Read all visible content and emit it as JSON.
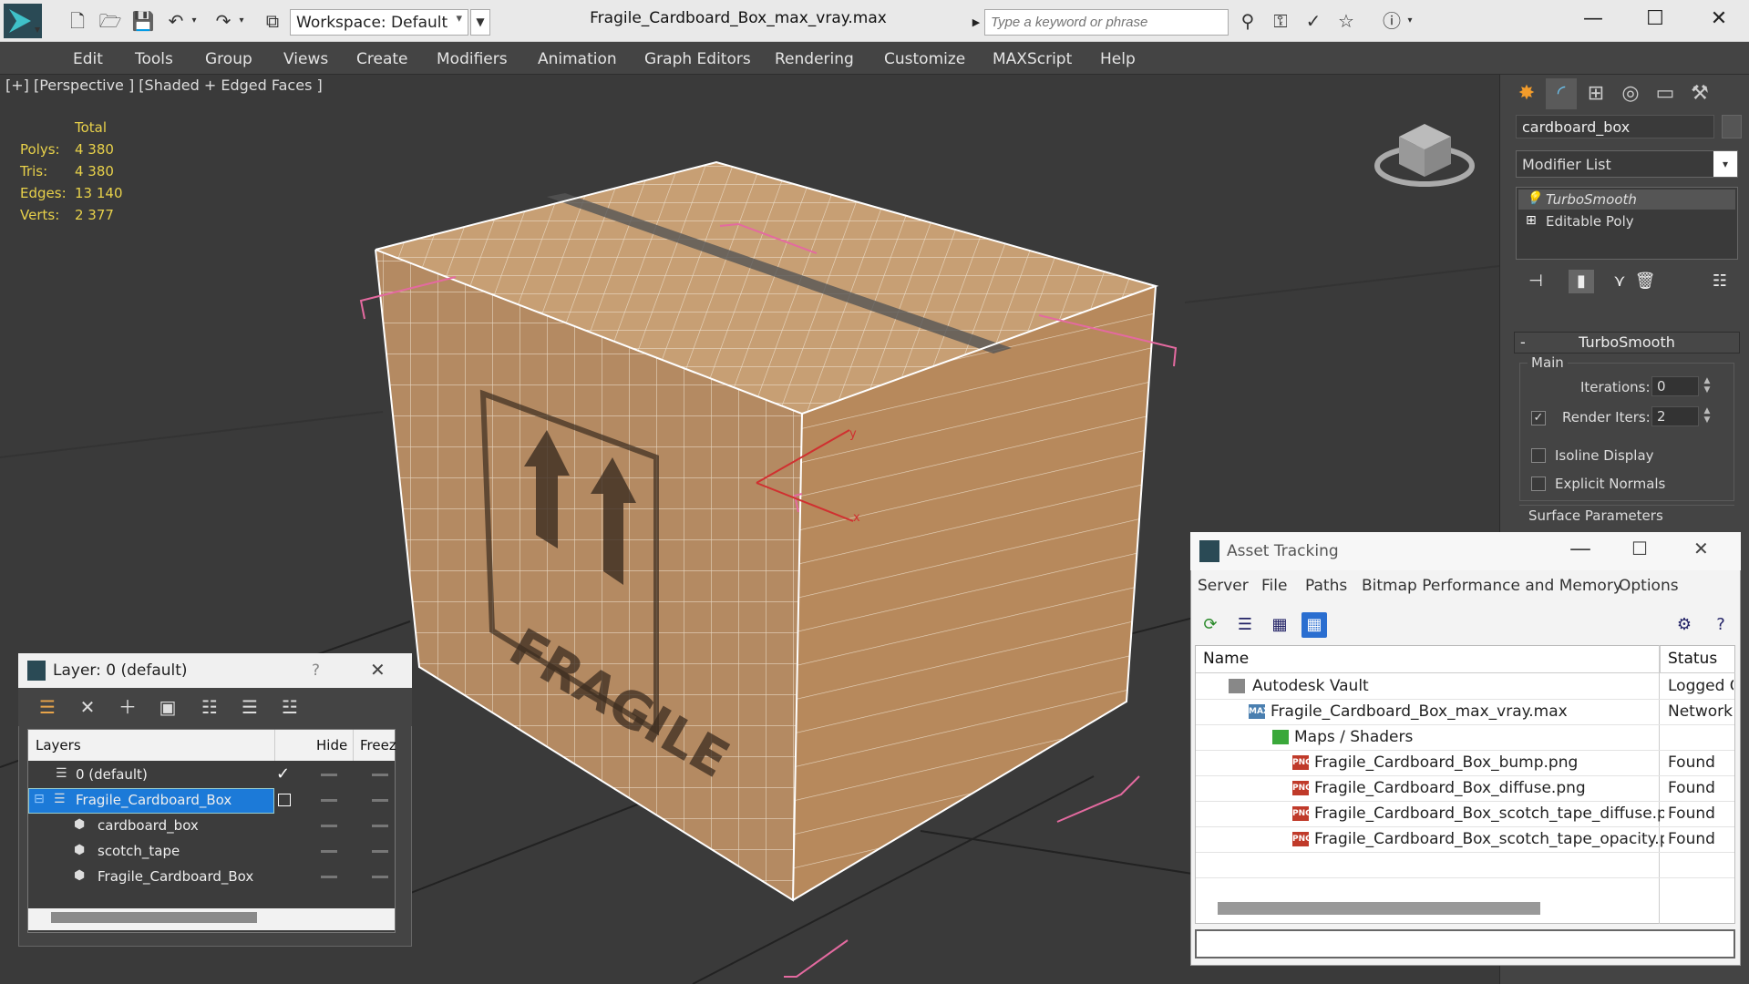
{
  "window": {
    "title": "Fragile_Cardboard_Box_max_vray.max",
    "workspace": "Workspace: Default",
    "search_placeholder": "Type a keyword or phrase",
    "minimize": "—",
    "maximize": "☐",
    "close": "✕"
  },
  "menu": [
    "Edit",
    "Tools",
    "Group",
    "Views",
    "Create",
    "Modifiers",
    "Animation",
    "Graph Editors",
    "Rendering",
    "Customize",
    "MAXScript",
    "Help"
  ],
  "viewport": {
    "label": "[+] [Perspective ] [Shaded + Edged Faces ]",
    "stats_header": "Total",
    "stats": [
      {
        "label": "Polys:",
        "value": "4 380"
      },
      {
        "label": "Tris:",
        "value": "4 380"
      },
      {
        "label": "Edges:",
        "value": "13 140"
      },
      {
        "label": "Verts:",
        "value": "2 377"
      }
    ],
    "box_text": "FRAGILE",
    "gizmo_x": "x",
    "gizmo_y": "y"
  },
  "command_panel": {
    "object_name": "cardboard_box",
    "modifier_list": "Modifier List",
    "stack": [
      "TurboSmooth",
      "Editable Poly"
    ],
    "rollout_title": "TurboSmooth",
    "group_main": "Main",
    "iterations_label": "Iterations:",
    "iterations_value": "0",
    "render_iters_label": "Render Iters:",
    "render_iters_value": "2",
    "isoline_label": "Isoline Display",
    "explicit_normals_label": "Explicit Normals",
    "surface_params": "Surface Parameters"
  },
  "layer_window": {
    "title": "Layer: 0 (default)",
    "help": "?",
    "close": "✕",
    "col_layers": "Layers",
    "col_hide": "Hide",
    "col_freeze": "Freez",
    "rows": [
      {
        "name": "0 (default)",
        "indent": 0,
        "check": "✓"
      },
      {
        "name": "Fragile_Cardboard_Box",
        "indent": 0,
        "selected": true
      },
      {
        "name": "cardboard_box",
        "indent": 1
      },
      {
        "name": "scotch_tape",
        "indent": 1
      },
      {
        "name": "Fragile_Cardboard_Box",
        "indent": 1
      }
    ]
  },
  "asset_window": {
    "title": "Asset Tracking",
    "menu": [
      "Server",
      "File",
      "Paths",
      "Bitmap Performance and Memory",
      "Options"
    ],
    "col_name": "Name",
    "col_status": "Status",
    "rows": [
      {
        "name": "Autodesk Vault",
        "status": "Logged O",
        "indent": 0,
        "icon": "vault"
      },
      {
        "name": "Fragile_Cardboard_Box_max_vray.max",
        "status": "Network",
        "indent": 1,
        "icon": "max"
      },
      {
        "name": "Maps / Shaders",
        "status": "",
        "indent": 2,
        "icon": "folder"
      },
      {
        "name": "Fragile_Cardboard_Box_bump.png",
        "status": "Found",
        "indent": 3,
        "icon": "png"
      },
      {
        "name": "Fragile_Cardboard_Box_diffuse.png",
        "status": "Found",
        "indent": 3,
        "icon": "png"
      },
      {
        "name": "Fragile_Cardboard_Box_scotch_tape_diffuse.png",
        "status": "Found",
        "indent": 3,
        "icon": "png"
      },
      {
        "name": "Fragile_Cardboard_Box_scotch_tape_opacity.p...",
        "status": "Found",
        "indent": 3,
        "icon": "png"
      }
    ]
  }
}
